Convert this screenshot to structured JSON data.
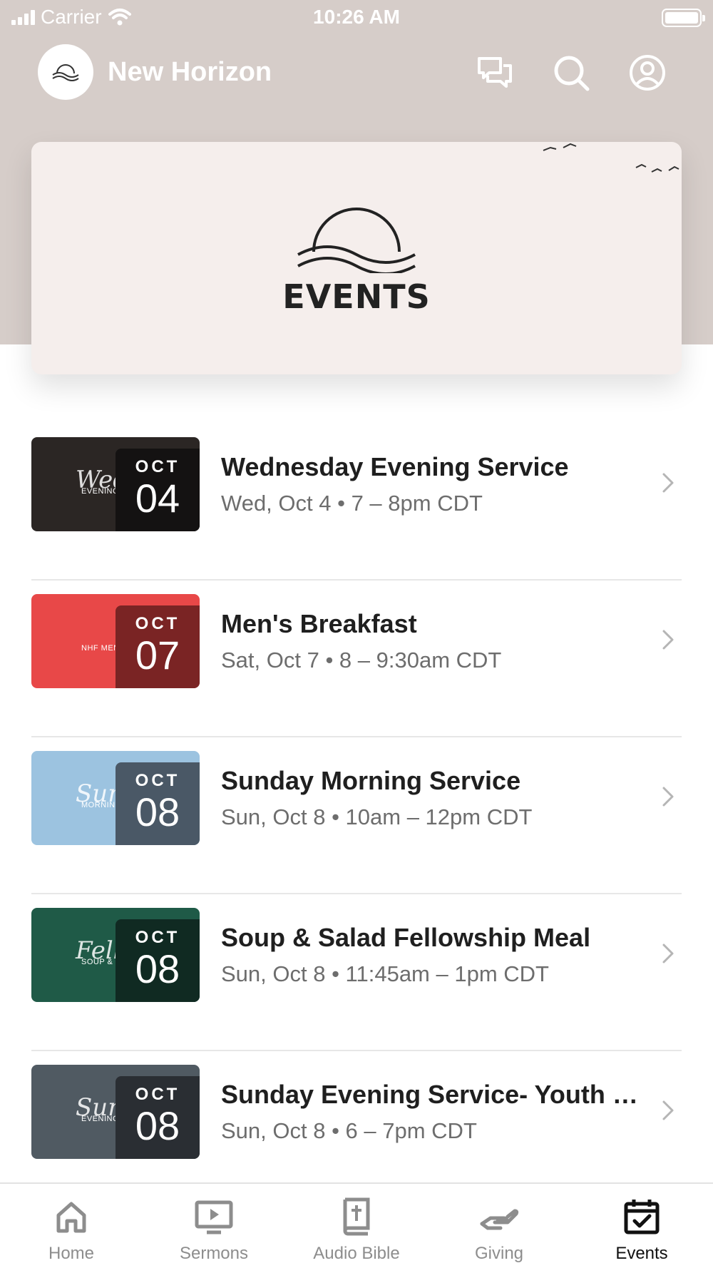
{
  "status_bar": {
    "carrier": "Carrier",
    "time": "10:26 AM"
  },
  "header": {
    "title": "New Horizon"
  },
  "banner": {
    "title": "EVENTS"
  },
  "events": [
    {
      "title": "Wednesday Evening Service",
      "meta": "Wed, Oct 4 • 7 – 8pm CDT",
      "month": "OCT",
      "day": "04",
      "thumb_script": "Wednesday",
      "thumb_sub": "EVENING SERVICE",
      "thumb_color": "#2b2624",
      "date_bg": "#141212"
    },
    {
      "title": "Men's Breakfast",
      "meta": "Sat, Oct 7 • 8 – 9:30am CDT",
      "month": "OCT",
      "day": "07",
      "thumb_script": "",
      "thumb_sub": "NHF MEN'S BREAKFAST",
      "thumb_color": "#e84848",
      "date_bg": "#7a2424"
    },
    {
      "title": "Sunday Morning Service",
      "meta": "Sun, Oct 8 • 10am – 12pm CDT",
      "month": "OCT",
      "day": "08",
      "thumb_script": "Sunday",
      "thumb_sub": "MORNING SERVICE",
      "thumb_color": "#9cc3e0",
      "date_bg": "#4a5866"
    },
    {
      "title": "Soup & Salad Fellowship Meal",
      "meta": "Sun, Oct 8 • 11:45am – 1pm CDT",
      "month": "OCT",
      "day": "08",
      "thumb_script": "Fellowship",
      "thumb_sub": "SOUP & SALAD",
      "thumb_color": "#1f5a47",
      "date_bg": "#102a22"
    },
    {
      "title": "Sunday Evening Service- Youth Night",
      "meta": "Sun, Oct 8 • 6 – 7pm CDT",
      "month": "OCT",
      "day": "08",
      "thumb_script": "Sunday",
      "thumb_sub": "EVENING SERVICE",
      "thumb_color": "#505a62",
      "date_bg": "#2a2e33"
    }
  ],
  "tabs": [
    {
      "label": "Home",
      "icon": "home-icon",
      "active": false
    },
    {
      "label": "Sermons",
      "icon": "play-screen-icon",
      "active": false
    },
    {
      "label": "Audio Bible",
      "icon": "bible-icon",
      "active": false
    },
    {
      "label": "Giving",
      "icon": "giving-hand-icon",
      "active": false
    },
    {
      "label": "Events",
      "icon": "calendar-check-icon",
      "active": true
    }
  ],
  "colors": {
    "header_bg": "#d6cdc9",
    "banner_bg": "#f5eeec",
    "inactive_tab": "#8d8d8d",
    "active_tab": "#111111"
  }
}
